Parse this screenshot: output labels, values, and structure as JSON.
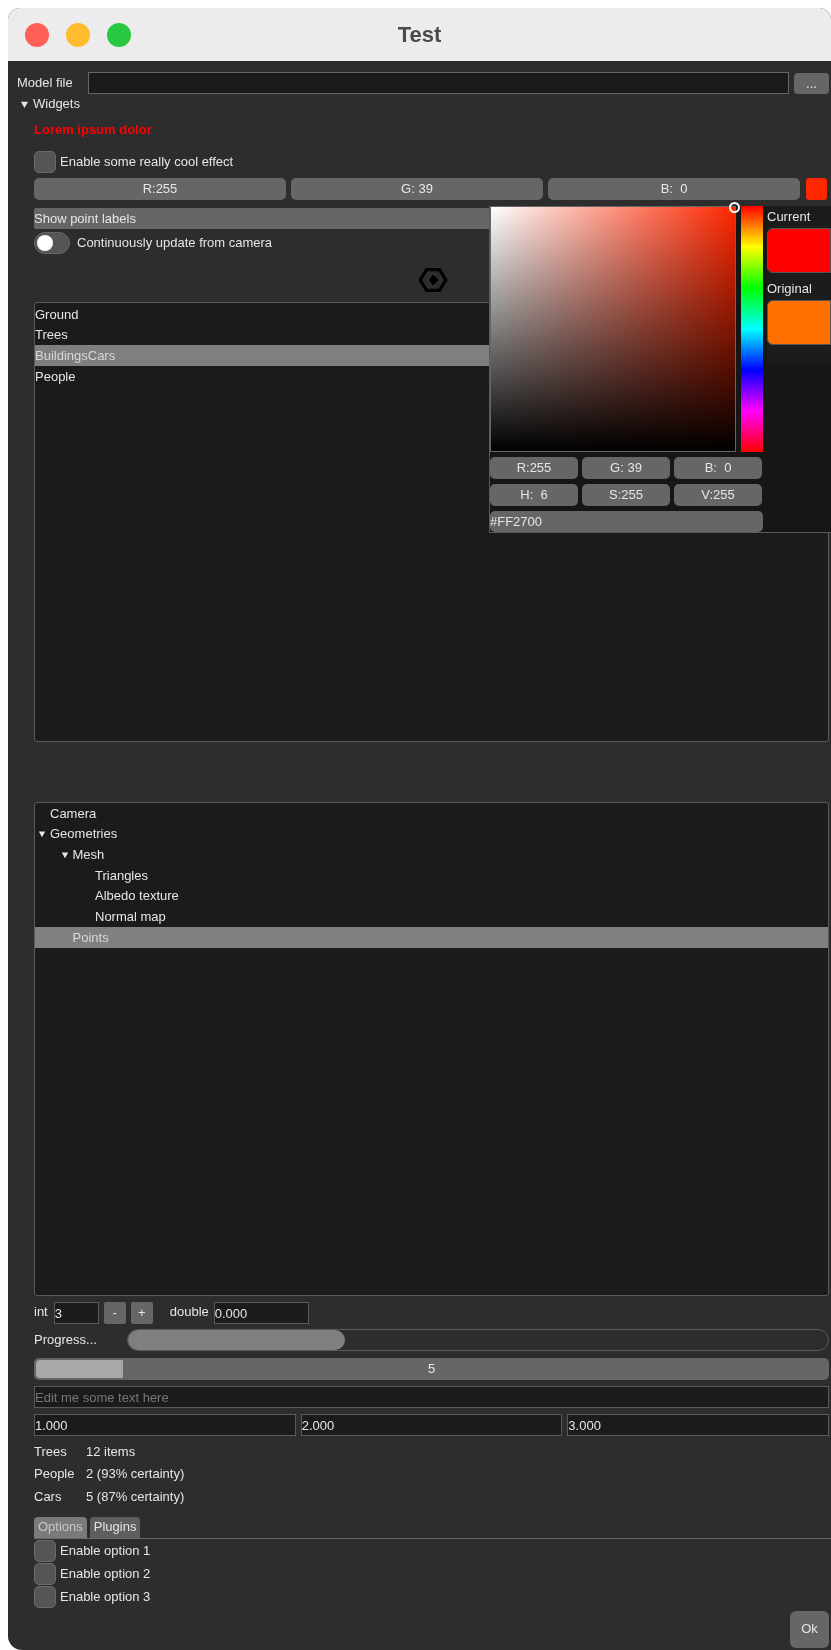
{
  "window": {
    "title": "Test"
  },
  "model_file": {
    "label": "Model file",
    "browse_button": "..."
  },
  "widgets": {
    "label": "Widgets",
    "expanded": true
  },
  "warning_text": "Lorem ipsum dolor",
  "effect_checkbox": {
    "label": "Enable some really cool effect",
    "checked": false
  },
  "color_edit": {
    "fields": [
      "R:255",
      "G: 39",
      "B:  0"
    ],
    "color": "#ff2700"
  },
  "point_labels_button": "Show point labels",
  "camera_toggle": {
    "label": "Continuously update from camera",
    "on": false
  },
  "list": {
    "items": [
      {
        "label": "Ground",
        "selected": false
      },
      {
        "label": "Trees",
        "selected": false
      },
      {
        "label": "BuildingsCars",
        "selected": true
      },
      {
        "label": "People",
        "selected": false
      }
    ]
  },
  "tree": {
    "items": [
      {
        "label": "Camera",
        "selected": false
      },
      {
        "label": "Geometries",
        "selected": false,
        "expanded": true,
        "children": [
          {
            "label": "Mesh",
            "selected": false,
            "expanded": true,
            "children": [
              {
                "label": "Triangles",
                "selected": false
              },
              {
                "label": "Albedo texture",
                "selected": false
              },
              {
                "label": "Normal map",
                "selected": false
              }
            ]
          },
          {
            "label": "Points",
            "selected": true
          }
        ]
      }
    ]
  },
  "int_field": {
    "label": "int",
    "value": "3",
    "decrement": "-",
    "increment": "+"
  },
  "double_field": {
    "label": "double",
    "value": "0.000"
  },
  "progress": {
    "label": "Progress...",
    "level": 0.31
  },
  "slider": {
    "value": "5",
    "level": 0.11
  },
  "text_edit": {
    "placeholder": "Edit me some text here"
  },
  "vector_fields": [
    "1.000",
    "2.000",
    "3.000"
  ],
  "stats": [
    {
      "name": "Trees",
      "value": "12 items"
    },
    {
      "name": "People",
      "value": "2 (93% certainty)"
    },
    {
      "name": "Cars",
      "value": "5 (87% certainty)"
    }
  ],
  "tabs": [
    {
      "label": "Options",
      "selected": true
    },
    {
      "label": "Plugins",
      "selected": false
    }
  ],
  "options": [
    {
      "label": "Enable option 1",
      "checked": false
    },
    {
      "label": "Enable option 2",
      "checked": false
    },
    {
      "label": "Enable option 3",
      "checked": false
    }
  ],
  "ok_button": "Ok",
  "color_picker": {
    "color": "#ff2700",
    "channels": [
      "R:255",
      "G: 39",
      "B:  0"
    ],
    "hsv": [
      "H:  6",
      "S:255",
      "V:255"
    ],
    "hex": "#FF2700",
    "current": {
      "label": "Current",
      "color": "#ff0000"
    },
    "original": {
      "label": "Original",
      "color": "#ff7000"
    }
  }
}
